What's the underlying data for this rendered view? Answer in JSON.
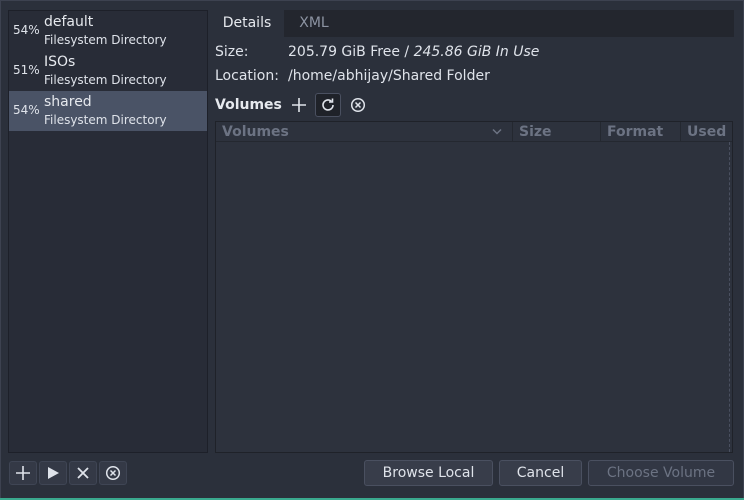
{
  "pools": [
    {
      "pct": "54%",
      "name": "default",
      "type": "Filesystem Directory",
      "selected": false
    },
    {
      "pct": "51%",
      "name": "ISOs",
      "type": "Filesystem Directory",
      "selected": false
    },
    {
      "pct": "54%",
      "name": "shared",
      "type": "Filesystem Directory",
      "selected": true
    }
  ],
  "tabs": {
    "details": "Details",
    "xml": "XML"
  },
  "details": {
    "size_label": "Size:",
    "size_free": "205.79 GiB Free",
    "size_sep": " / ",
    "size_used": "245.86 GiB In Use",
    "location_label": "Location:",
    "location_value": "/home/abhijay/Shared Folder"
  },
  "volumes": {
    "title": "Volumes",
    "columns": [
      "Volumes",
      "Size",
      "Format",
      "Used By"
    ]
  },
  "buttons": {
    "browse_local": "Browse Local",
    "cancel": "Cancel",
    "choose_volume": "Choose Volume"
  },
  "colors": {
    "accent": "#3aa98e",
    "selection": "#4a5366"
  }
}
